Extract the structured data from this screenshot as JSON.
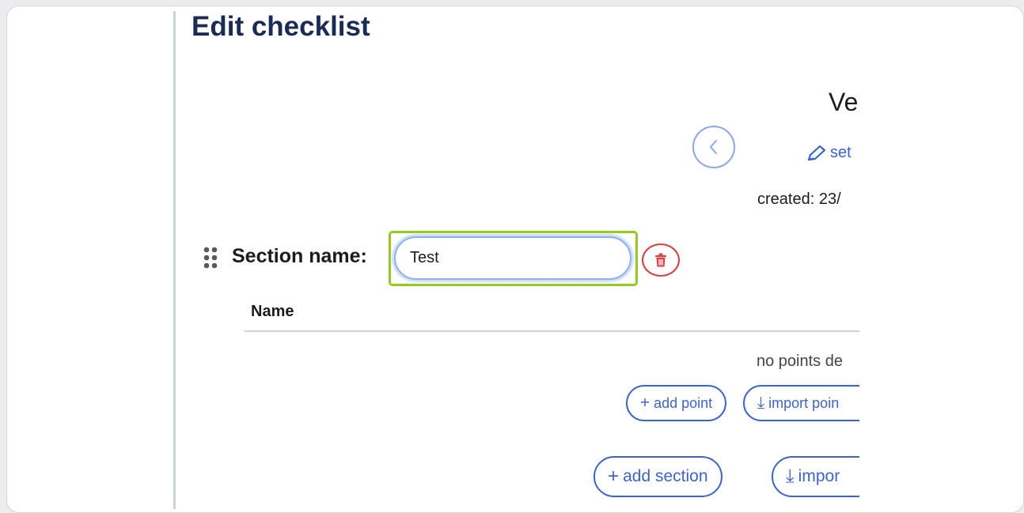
{
  "page": {
    "title": "Edit checklist"
  },
  "version": {
    "title": "Ve",
    "set_link": "set",
    "created": "created: 23/"
  },
  "section": {
    "label": "Section name:",
    "name_value": "Test"
  },
  "table": {
    "column_name": "Name",
    "empty_text": "no points de"
  },
  "actions": {
    "add_point": "add point",
    "import_points": "import poin",
    "add_section": "add section",
    "import_section": "impor",
    "plus_glyph": "+",
    "import_glyph": "⤓"
  },
  "colors": {
    "title": "#1a2b57",
    "accent": "#3b63d9",
    "danger": "#e23b3b",
    "highlight": "#94cc1d"
  }
}
